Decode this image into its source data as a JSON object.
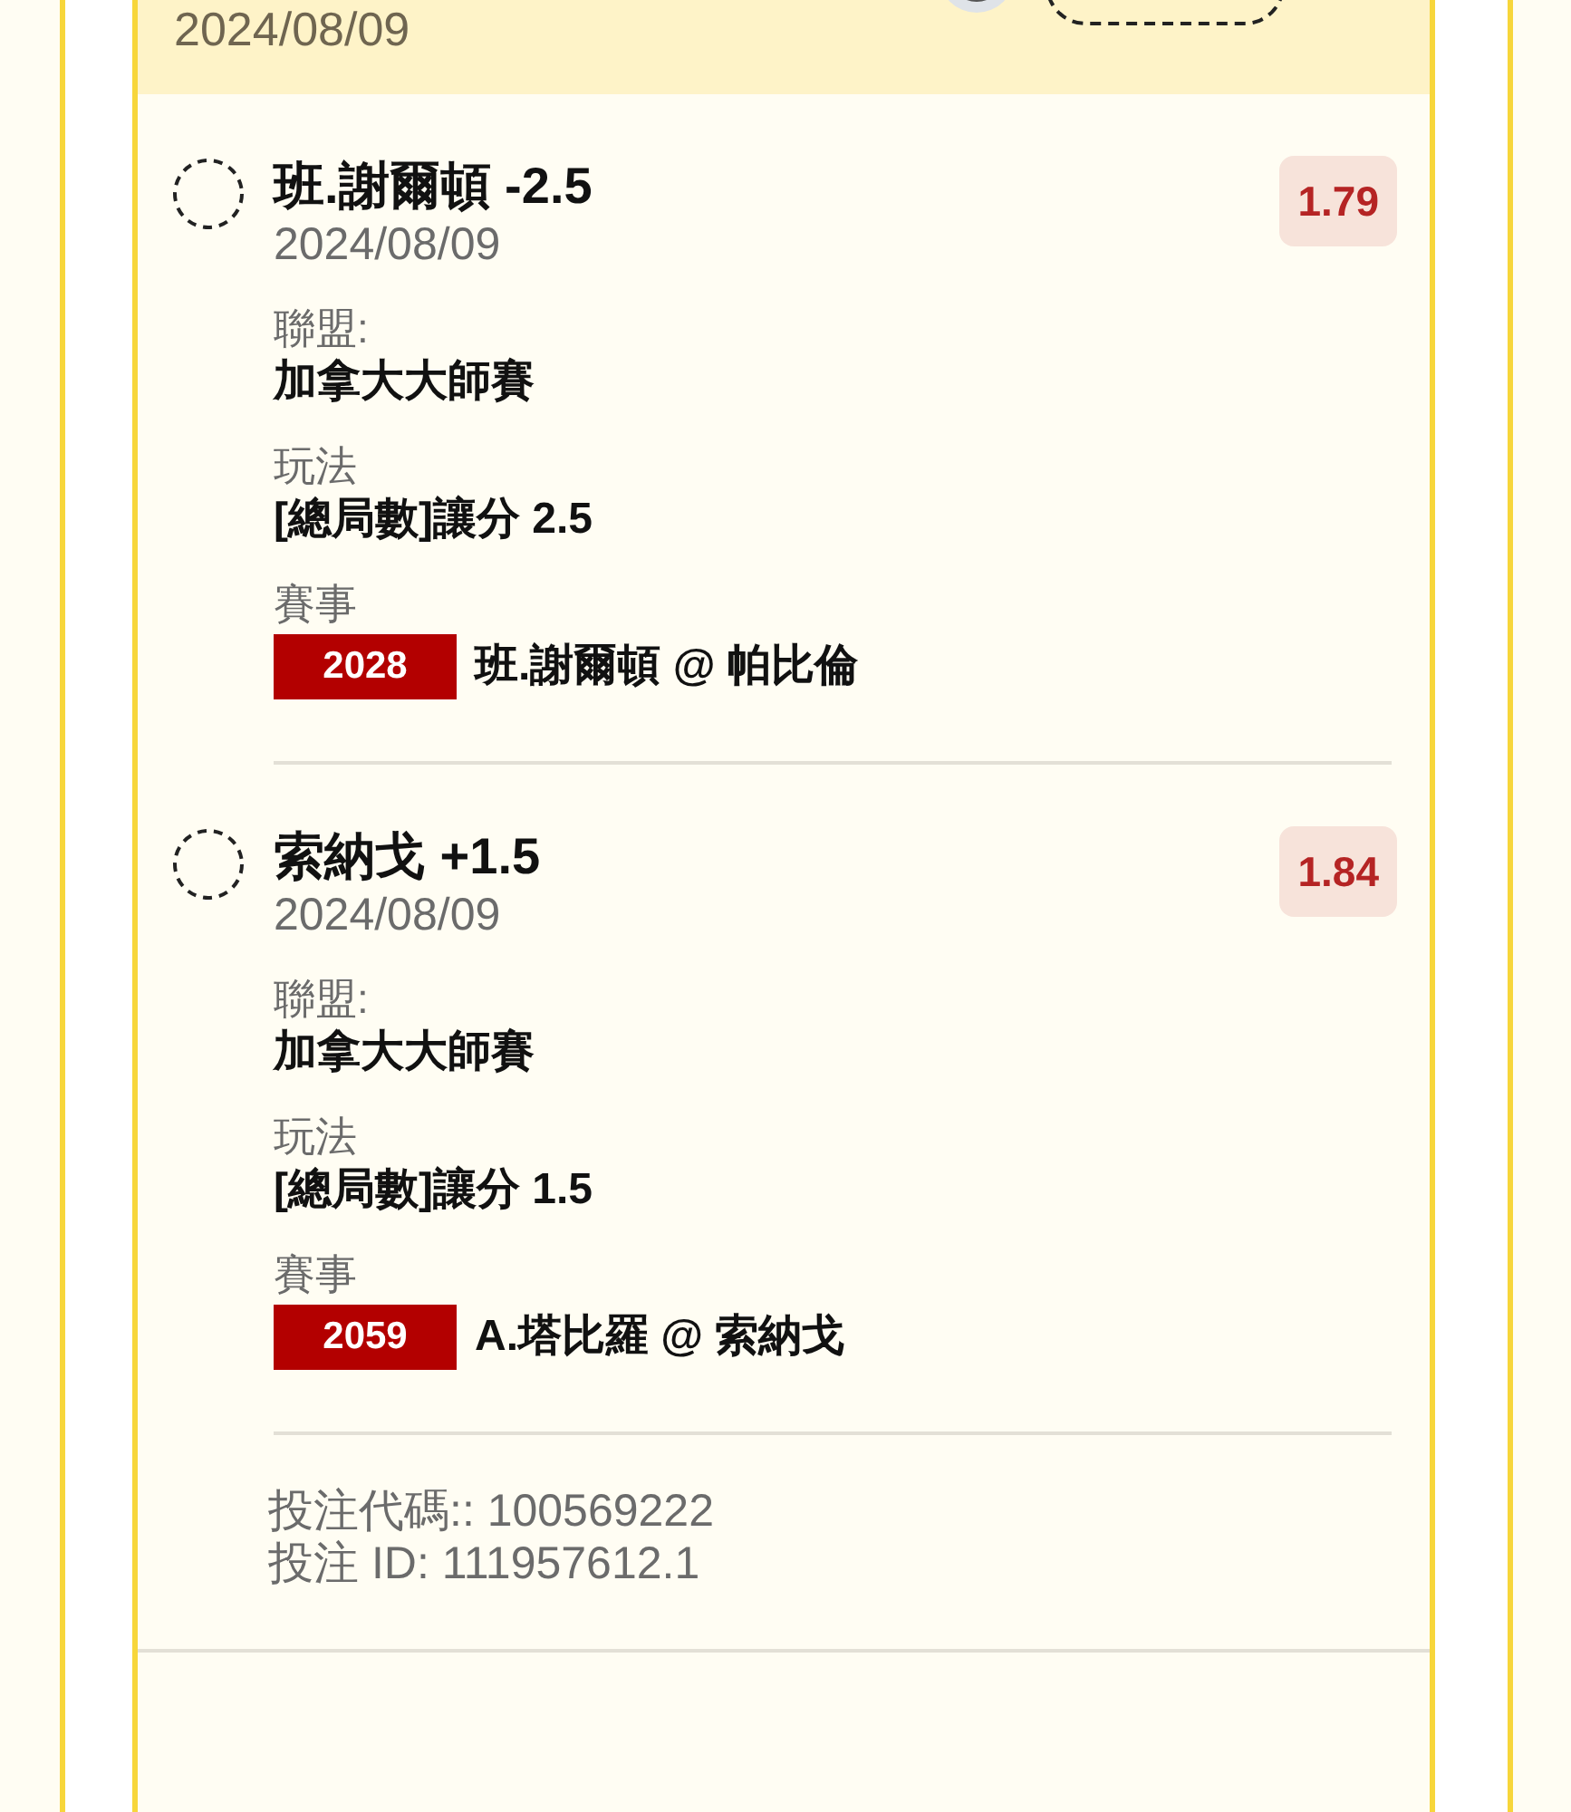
{
  "header": {
    "date": "2024/08/09"
  },
  "legs": [
    {
      "selected": false,
      "selection": "班.謝爾頓 -2.5",
      "date": "2024/08/09",
      "odds": "1.79",
      "league_label": "聯盟:",
      "league": "加拿大大師賽",
      "market_label": "玩法",
      "market": "[總局數]讓分 2.5",
      "event_label": "賽事",
      "event_code": "2028",
      "event": "班.謝爾頓 @ 帕比倫"
    },
    {
      "selected": false,
      "selection": "索納戈 +1.5",
      "date": "2024/08/09",
      "odds": "1.84",
      "league_label": "聯盟:",
      "league": "加拿大大師賽",
      "market_label": "玩法",
      "market": "[總局數]讓分 1.5",
      "event_label": "賽事",
      "event_code": "2059",
      "event": "A.塔比羅 @ 索納戈"
    }
  ],
  "footer": {
    "bet_code": "投注代碼:: 100569222",
    "bet_id": "投注 ID: 111957612.1"
  }
}
